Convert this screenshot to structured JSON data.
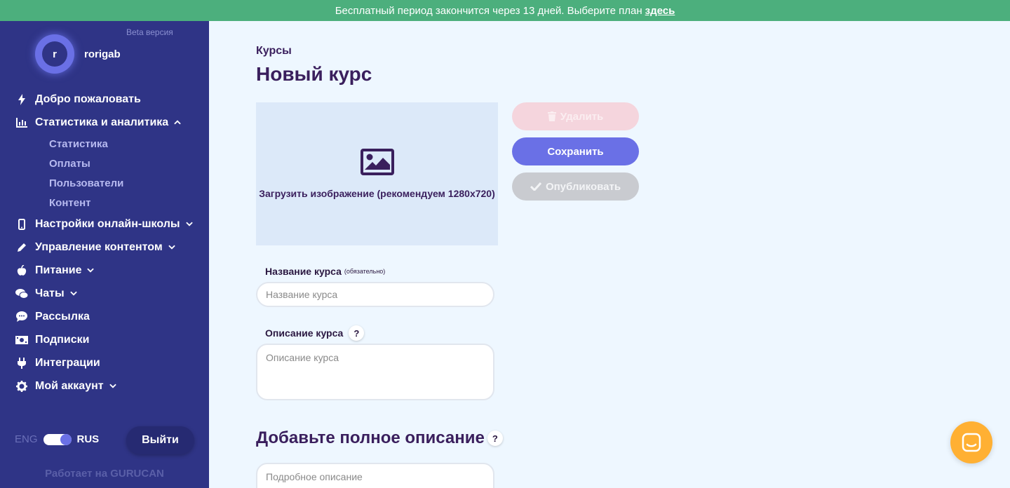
{
  "banner": {
    "text": "Бесплатный период закончится через 13 дней. Выберите план",
    "link": "здесь"
  },
  "sidebar": {
    "beta": "Beta версия",
    "avatar_letter": "r",
    "username": "rorigab",
    "items": [
      {
        "label": "Добро пожаловать",
        "icon": "bolt-icon"
      },
      {
        "label": "Статистика и аналитика",
        "icon": "chart-icon",
        "chevron": "up"
      },
      {
        "label": "Настройки онлайн-школы",
        "icon": "phone-icon",
        "chevron": "down"
      },
      {
        "label": "Управление контентом",
        "icon": "pencil-icon",
        "chevron": "down"
      },
      {
        "label": "Питание",
        "icon": "apple-icon",
        "chevron": "down"
      },
      {
        "label": "Чаты",
        "icon": "chats-icon",
        "chevron": "down"
      },
      {
        "label": "Рассылка",
        "icon": "comment-icon"
      },
      {
        "label": "Подписки",
        "icon": "money-icon"
      },
      {
        "label": "Интеграции",
        "icon": "plug-icon"
      },
      {
        "label": "Мой аккаунт",
        "icon": "gear-icon",
        "chevron": "down"
      }
    ],
    "subitems": [
      "Статистика",
      "Оплаты",
      "Пользователи",
      "Контент"
    ],
    "lang_eng": "ENG",
    "lang_rus": "RUS",
    "logout": "Выйти",
    "powered": "Работает на GURUCAN"
  },
  "main": {
    "breadcrumb": "Курсы",
    "title": "Новый курс",
    "upload_label": "Загрузить изображение (рекомендуем 1280x720)",
    "delete_btn": "Удалить",
    "save_btn": "Сохранить",
    "publish_btn": "Опубликовать",
    "name_label": "Название курса",
    "name_required": "(обязательно)",
    "name_placeholder": "Название курса",
    "desc_label": "Описание курса",
    "desc_placeholder": "Описание курса",
    "full_title": "Добавьте полное описание",
    "full_placeholder": "Подробное описание",
    "help_mark": "?"
  },
  "colors": {
    "banner": "#4caf7d",
    "sidebar": "#2f3486",
    "accent": "#6a70e6",
    "chat": "#ffb033"
  }
}
